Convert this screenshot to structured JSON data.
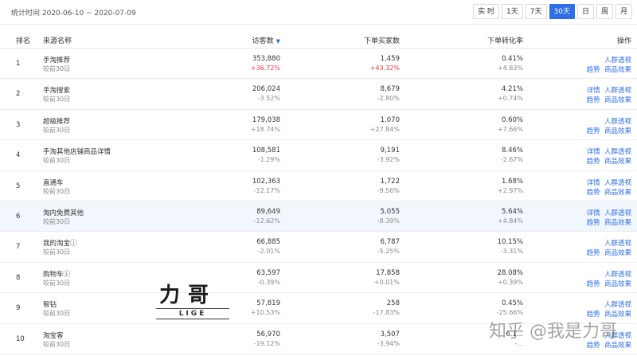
{
  "period_label": "统计时间 2020-06-10 ~ 2020-07-09",
  "time_buttons": [
    "实 时",
    "1天",
    "7天",
    "30天",
    "日",
    "周",
    "月"
  ],
  "active_button_index": 3,
  "nav_icon": "chevron-down-icon",
  "columns": {
    "rank": "排名",
    "source": "来源名称",
    "visitors": "访客数",
    "buyers": "下单买家数",
    "conversion": "下单转化率",
    "ops": "操作"
  },
  "compare_label": "较前30日",
  "ops_labels": {
    "detail": "详情",
    "crowd": "人群透视",
    "trend": "趋势",
    "goods": "商品效果"
  },
  "rows": [
    {
      "rank": "1",
      "name": "手淘推荐",
      "visitors": "353,880",
      "visitors_change": "+36.72%",
      "visitors_up": true,
      "buyers": "1,459",
      "buyers_change": "+43.32%",
      "buyers_up": true,
      "conv": "0.41%",
      "conv_change": "+4.83%",
      "detail": false
    },
    {
      "rank": "2",
      "name": "手淘搜索",
      "visitors": "206,024",
      "visitors_change": "-3.52%",
      "visitors_up": false,
      "buyers": "8,679",
      "buyers_change": "-2.80%",
      "buyers_up": false,
      "conv": "4.21%",
      "conv_change": "+0.74%",
      "detail": true
    },
    {
      "rank": "3",
      "name": "超级推荐",
      "visitors": "179,038",
      "visitors_change": "+18.74%",
      "visitors_up": false,
      "buyers": "1,070",
      "buyers_change": "+27.84%",
      "buyers_up": false,
      "conv": "0.60%",
      "conv_change": "+7.66%",
      "detail": false
    },
    {
      "rank": "4",
      "name": "手淘其他店铺商品详情",
      "visitors": "108,581",
      "visitors_change": "-1.29%",
      "visitors_up": false,
      "buyers": "9,191",
      "buyers_change": "-3.92%",
      "buyers_up": false,
      "conv": "8.46%",
      "conv_change": "-2.67%",
      "detail": true
    },
    {
      "rank": "5",
      "name": "直通车",
      "visitors": "102,363",
      "visitors_change": "-12.17%",
      "visitors_up": false,
      "buyers": "1,722",
      "buyers_change": "-9.56%",
      "buyers_up": false,
      "conv": "1.68%",
      "conv_change": "+2.97%",
      "detail": true
    },
    {
      "rank": "6",
      "name": "淘内免费其他",
      "visitors": "89,649",
      "visitors_change": "-12.62%",
      "visitors_up": false,
      "buyers": "5,055",
      "buyers_change": "-8.39%",
      "buyers_up": false,
      "conv": "5.64%",
      "conv_change": "+4.84%",
      "detail": true,
      "highlight": true
    },
    {
      "rank": "7",
      "name": "我的淘宝ⓘ",
      "visitors": "66,885",
      "visitors_change": "-2.01%",
      "visitors_up": false,
      "buyers": "6,787",
      "buyers_change": "-5.25%",
      "buyers_up": false,
      "conv": "10.15%",
      "conv_change": "-3.31%",
      "detail": false
    },
    {
      "rank": "8",
      "name": "购物车ⓘ",
      "visitors": "63,597",
      "visitors_change": "-0.39%",
      "visitors_up": false,
      "buyers": "17,858",
      "buyers_change": "+0.01%",
      "buyers_up": false,
      "conv": "28.08%",
      "conv_change": "+0.39%",
      "detail": false
    },
    {
      "rank": "9",
      "name": "智钻",
      "visitors": "57,819",
      "visitors_change": "+10.53%",
      "visitors_up": false,
      "buyers": "258",
      "buyers_change": "-17.83%",
      "buyers_up": false,
      "conv": "0.45%",
      "conv_change": "-25.66%",
      "detail": false
    },
    {
      "rank": "10",
      "name": "淘宝客",
      "visitors": "56,970",
      "visitors_change": "-19.12%",
      "visitors_up": false,
      "buyers": "3,507",
      "buyers_change": "-3.94%",
      "buyers_up": false,
      "conv": "6.1...",
      "conv_change": "-...",
      "detail": false
    }
  ],
  "watermark_logo": "力哥",
  "watermark_logo_sub": "LIGE",
  "watermark_text": "知乎 @我是力哥",
  "colors": {
    "accent": "#2f6fe4",
    "up": "#e0383e",
    "highlight_row": "#f2f7fe"
  }
}
